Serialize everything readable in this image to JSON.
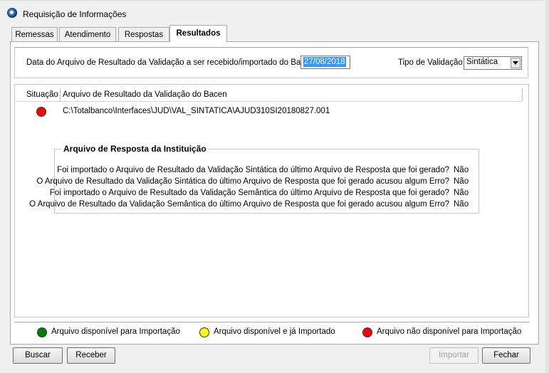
{
  "window": {
    "title": "Requisição de Informações"
  },
  "tabs": [
    {
      "label": "Remessas"
    },
    {
      "label": "Atendimento"
    },
    {
      "label": "Respostas"
    },
    {
      "label": "Resultados"
    }
  ],
  "filters": {
    "date_label": "Data do Arquivo de Resultado da Validação a ser recebido/importado do Bacen:",
    "date_value": "27/08/2018",
    "validation_label": "Tipo de Validação:",
    "validation_value": "Sintática"
  },
  "list": {
    "columns": [
      "Situação",
      "Arquivo de Resultado da Validação do Bacen"
    ],
    "rows": [
      {
        "status": "red",
        "file": "C:\\Totalbanco\\Interfaces\\JUD\\VAL_SINTATICA\\AJUD310SI20180827.001"
      }
    ]
  },
  "response_group": {
    "title": "Arquivo de Resposta da Instituição",
    "items": [
      {
        "question": "Foi importado o Arquivo de Resultado da Validação Sintática do último Arquivo de Resposta que foi gerado?",
        "answer": "Não"
      },
      {
        "question": "O Arquivo de Resultado da Validação Sintática do último Arquivo de Resposta que foi gerado acusou algum Erro?",
        "answer": "Não"
      },
      {
        "question": "Foi importado o Arquivo de Resultado da Validação Semântica do último Arquivo de Resposta que foi gerado?",
        "answer": "Não"
      },
      {
        "question": "O Arquivo de Resultado da Validação Semântica do último Arquivo de Resposta que foi gerado acusou algum Erro?",
        "answer": "Não"
      }
    ]
  },
  "legend": [
    {
      "color": "#008000",
      "label": "Arquivo disponível para Importação"
    },
    {
      "color": "#ffff00",
      "label": "Arquivo disponível e já Importado"
    },
    {
      "color": "#ff0000",
      "label": "Arquivo não disponível para Importação"
    }
  ],
  "buttons": {
    "buscar": "Buscar",
    "receber": "Receber",
    "importar": "Importar",
    "fechar": "Fechar"
  }
}
